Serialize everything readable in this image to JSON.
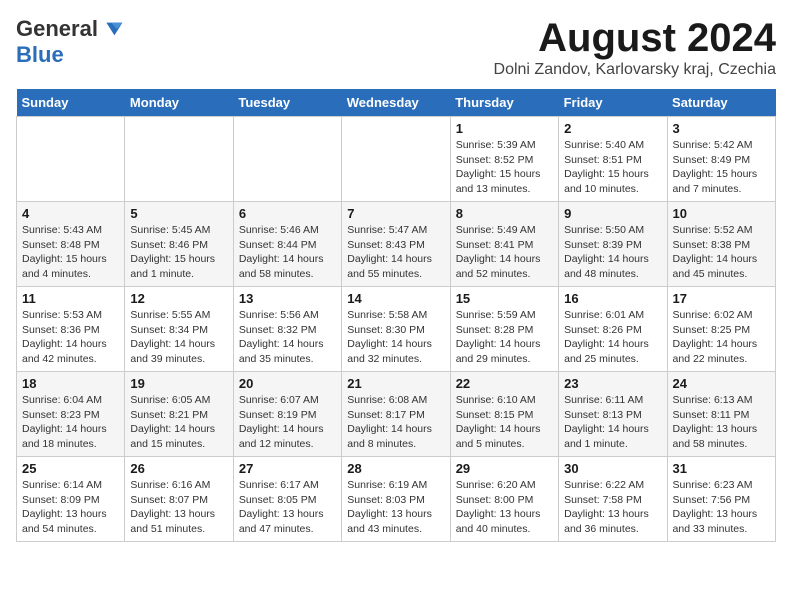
{
  "header": {
    "logo_general": "General",
    "logo_blue": "Blue",
    "month_year": "August 2024",
    "location": "Dolni Zandov, Karlovarsky kraj, Czechia"
  },
  "weekdays": [
    "Sunday",
    "Monday",
    "Tuesday",
    "Wednesday",
    "Thursday",
    "Friday",
    "Saturday"
  ],
  "weeks": [
    [
      {
        "day": "",
        "info": ""
      },
      {
        "day": "",
        "info": ""
      },
      {
        "day": "",
        "info": ""
      },
      {
        "day": "",
        "info": ""
      },
      {
        "day": "1",
        "info": "Sunrise: 5:39 AM\nSunset: 8:52 PM\nDaylight: 15 hours\nand 13 minutes."
      },
      {
        "day": "2",
        "info": "Sunrise: 5:40 AM\nSunset: 8:51 PM\nDaylight: 15 hours\nand 10 minutes."
      },
      {
        "day": "3",
        "info": "Sunrise: 5:42 AM\nSunset: 8:49 PM\nDaylight: 15 hours\nand 7 minutes."
      }
    ],
    [
      {
        "day": "4",
        "info": "Sunrise: 5:43 AM\nSunset: 8:48 PM\nDaylight: 15 hours\nand 4 minutes."
      },
      {
        "day": "5",
        "info": "Sunrise: 5:45 AM\nSunset: 8:46 PM\nDaylight: 15 hours\nand 1 minute."
      },
      {
        "day": "6",
        "info": "Sunrise: 5:46 AM\nSunset: 8:44 PM\nDaylight: 14 hours\nand 58 minutes."
      },
      {
        "day": "7",
        "info": "Sunrise: 5:47 AM\nSunset: 8:43 PM\nDaylight: 14 hours\nand 55 minutes."
      },
      {
        "day": "8",
        "info": "Sunrise: 5:49 AM\nSunset: 8:41 PM\nDaylight: 14 hours\nand 52 minutes."
      },
      {
        "day": "9",
        "info": "Sunrise: 5:50 AM\nSunset: 8:39 PM\nDaylight: 14 hours\nand 48 minutes."
      },
      {
        "day": "10",
        "info": "Sunrise: 5:52 AM\nSunset: 8:38 PM\nDaylight: 14 hours\nand 45 minutes."
      }
    ],
    [
      {
        "day": "11",
        "info": "Sunrise: 5:53 AM\nSunset: 8:36 PM\nDaylight: 14 hours\nand 42 minutes."
      },
      {
        "day": "12",
        "info": "Sunrise: 5:55 AM\nSunset: 8:34 PM\nDaylight: 14 hours\nand 39 minutes."
      },
      {
        "day": "13",
        "info": "Sunrise: 5:56 AM\nSunset: 8:32 PM\nDaylight: 14 hours\nand 35 minutes."
      },
      {
        "day": "14",
        "info": "Sunrise: 5:58 AM\nSunset: 8:30 PM\nDaylight: 14 hours\nand 32 minutes."
      },
      {
        "day": "15",
        "info": "Sunrise: 5:59 AM\nSunset: 8:28 PM\nDaylight: 14 hours\nand 29 minutes."
      },
      {
        "day": "16",
        "info": "Sunrise: 6:01 AM\nSunset: 8:26 PM\nDaylight: 14 hours\nand 25 minutes."
      },
      {
        "day": "17",
        "info": "Sunrise: 6:02 AM\nSunset: 8:25 PM\nDaylight: 14 hours\nand 22 minutes."
      }
    ],
    [
      {
        "day": "18",
        "info": "Sunrise: 6:04 AM\nSunset: 8:23 PM\nDaylight: 14 hours\nand 18 minutes."
      },
      {
        "day": "19",
        "info": "Sunrise: 6:05 AM\nSunset: 8:21 PM\nDaylight: 14 hours\nand 15 minutes."
      },
      {
        "day": "20",
        "info": "Sunrise: 6:07 AM\nSunset: 8:19 PM\nDaylight: 14 hours\nand 12 minutes."
      },
      {
        "day": "21",
        "info": "Sunrise: 6:08 AM\nSunset: 8:17 PM\nDaylight: 14 hours\nand 8 minutes."
      },
      {
        "day": "22",
        "info": "Sunrise: 6:10 AM\nSunset: 8:15 PM\nDaylight: 14 hours\nand 5 minutes."
      },
      {
        "day": "23",
        "info": "Sunrise: 6:11 AM\nSunset: 8:13 PM\nDaylight: 14 hours\nand 1 minute."
      },
      {
        "day": "24",
        "info": "Sunrise: 6:13 AM\nSunset: 8:11 PM\nDaylight: 13 hours\nand 58 minutes."
      }
    ],
    [
      {
        "day": "25",
        "info": "Sunrise: 6:14 AM\nSunset: 8:09 PM\nDaylight: 13 hours\nand 54 minutes."
      },
      {
        "day": "26",
        "info": "Sunrise: 6:16 AM\nSunset: 8:07 PM\nDaylight: 13 hours\nand 51 minutes."
      },
      {
        "day": "27",
        "info": "Sunrise: 6:17 AM\nSunset: 8:05 PM\nDaylight: 13 hours\nand 47 minutes."
      },
      {
        "day": "28",
        "info": "Sunrise: 6:19 AM\nSunset: 8:03 PM\nDaylight: 13 hours\nand 43 minutes."
      },
      {
        "day": "29",
        "info": "Sunrise: 6:20 AM\nSunset: 8:00 PM\nDaylight: 13 hours\nand 40 minutes."
      },
      {
        "day": "30",
        "info": "Sunrise: 6:22 AM\nSunset: 7:58 PM\nDaylight: 13 hours\nand 36 minutes."
      },
      {
        "day": "31",
        "info": "Sunrise: 6:23 AM\nSunset: 7:56 PM\nDaylight: 13 hours\nand 33 minutes."
      }
    ]
  ]
}
